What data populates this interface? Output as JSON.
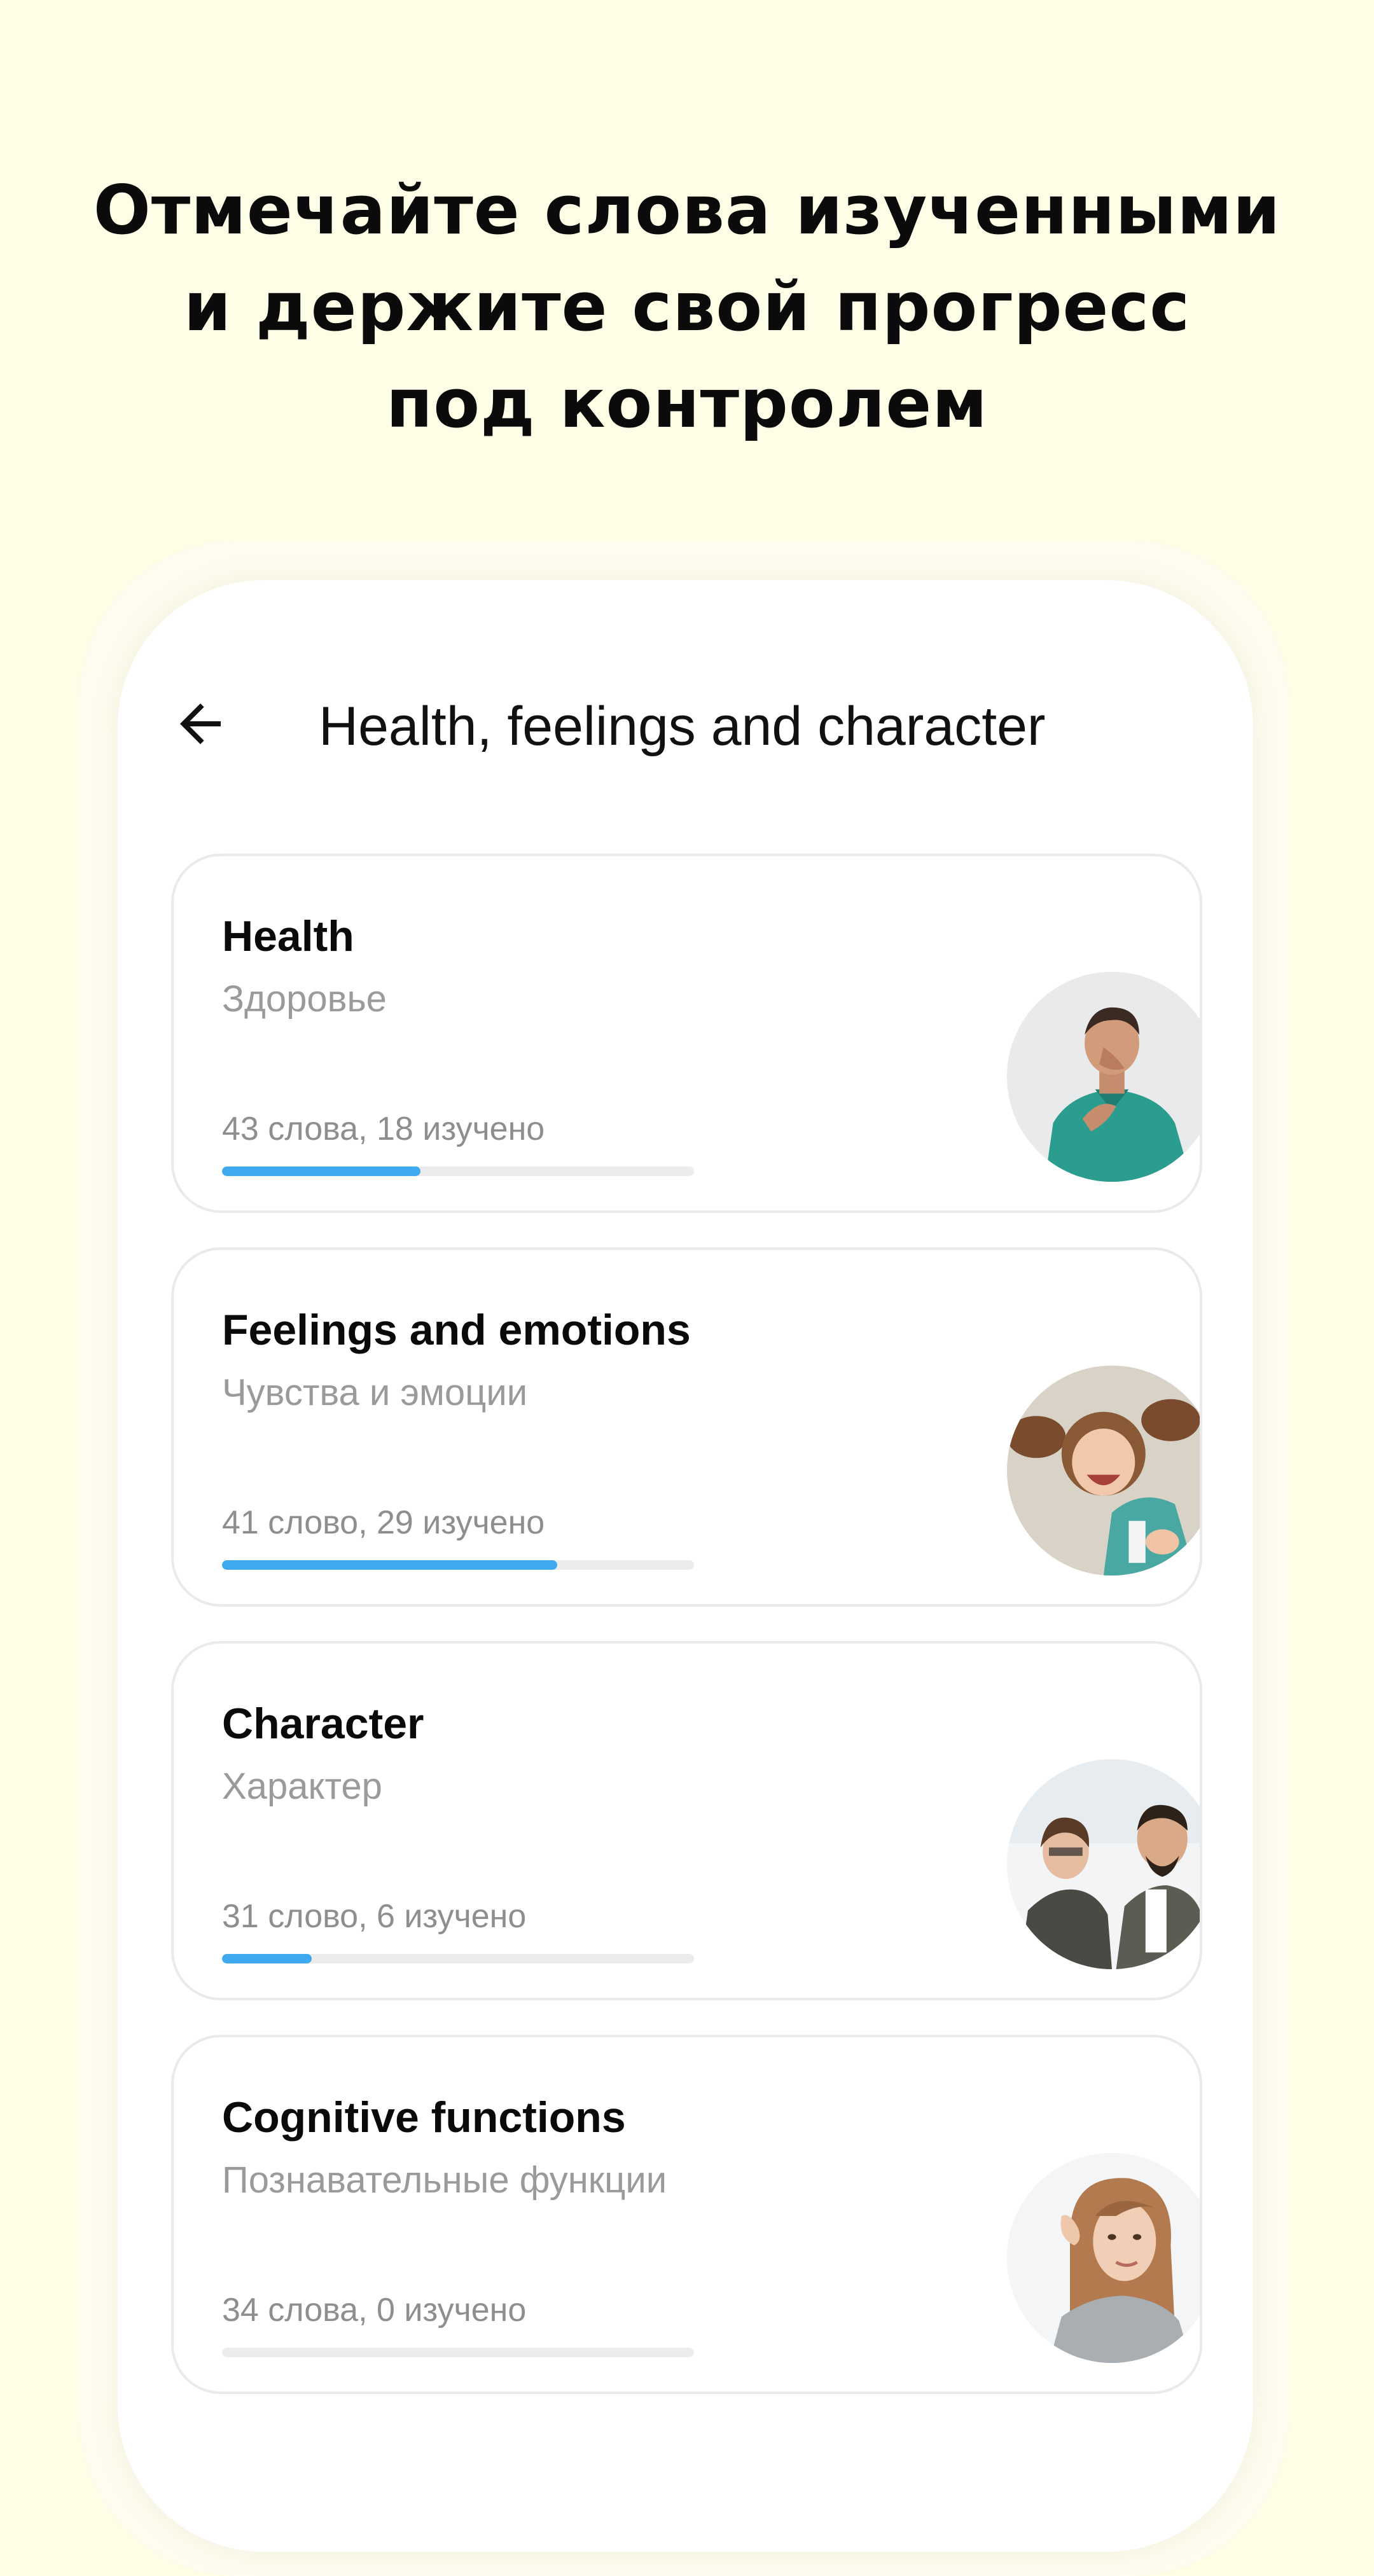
{
  "promo": {
    "headline_lines": [
      "Отмечайте слова изученными",
      "и держите свой прогресс",
      "под контролем"
    ]
  },
  "screen": {
    "title": "Health, feelings and character",
    "back_icon": "arrow-left-icon"
  },
  "topics": [
    {
      "title": "Health",
      "subtitle": "Здоровье",
      "stats": "43 слова, 18 изучено",
      "words_total": 43,
      "words_learned": 18,
      "progress": 0.42,
      "photo": "man-coughing-photo"
    },
    {
      "title": "Feelings and emotions",
      "subtitle": "Чувства и эмоции",
      "stats": "41 слово, 29 изучено",
      "words_total": 41,
      "words_learned": 29,
      "progress": 0.71,
      "photo": "laughing-girl-photo"
    },
    {
      "title": "Character",
      "subtitle": "Характер",
      "stats": "31 слово, 6 изучено",
      "words_total": 31,
      "words_learned": 6,
      "progress": 0.19,
      "photo": "office-colleagues-photo"
    },
    {
      "title": "Cognitive functions",
      "subtitle": "Познавательные функции",
      "stats": "34 слова, 0 изучено",
      "words_total": 34,
      "words_learned": 0,
      "progress": 0.0,
      "photo": "woman-listening-photo"
    }
  ],
  "colors": {
    "background": "#fefde6",
    "progress_fill": "#3fa9ef",
    "progress_track": "#ececec",
    "subtitle_text": "#9a9a9a"
  }
}
